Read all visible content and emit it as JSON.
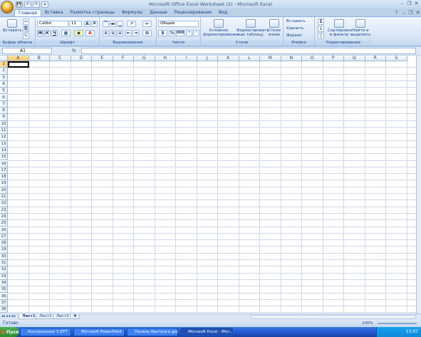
{
  "window": {
    "title": "Microsoft Office Excel Worksheet (2) - Microsoft Excel",
    "controls": [
      "–",
      "❐",
      "✕"
    ],
    "doc_controls": [
      "?",
      "–",
      "❐",
      "✕"
    ]
  },
  "qat": [
    "💾",
    "↶",
    "↷",
    "▾"
  ],
  "tabs": [
    "Главная",
    "Вставка",
    "Разметка страницы",
    "Формулы",
    "Данные",
    "Рецензирование",
    "Вид"
  ],
  "ribbon": {
    "clipboard": {
      "label": "Буфер обмена",
      "paste": "Вставить"
    },
    "font": {
      "label": "Шрифт",
      "name": "Calibri",
      "size": "11",
      "bold": "Ж",
      "italic": "К",
      "underline": "Ч",
      "grow": "A",
      "shrink": "A"
    },
    "align": {
      "label": "Выравнивание"
    },
    "number": {
      "label": "Число",
      "format": "Общий",
      "percent": "%",
      "thousands": "000"
    },
    "styles": {
      "label": "Стили",
      "cond": "Условное форматирование",
      "table": "Форматировать как таблицу",
      "cell": "Стили ячеек"
    },
    "cells": {
      "label": "Ячейки",
      "insert": "Вставить",
      "delete": "Удалить",
      "format": "Формат"
    },
    "editing": {
      "label": "Редактирование",
      "sum": "Σ",
      "sort": "Сортировка и фильтр",
      "find": "Найти и выделить"
    }
  },
  "formula_bar": {
    "cell_ref": "A1",
    "fx": "fx",
    "value": ""
  },
  "columns": [
    "A",
    "B",
    "C",
    "D",
    "E",
    "F",
    "G",
    "H",
    "I",
    "J",
    "K",
    "L",
    "M",
    "N",
    "O",
    "P",
    "Q",
    "R",
    "S"
  ],
  "rows": [
    "1",
    "2",
    "3",
    "4",
    "5",
    "6",
    "7",
    "8",
    "9",
    "10",
    "11",
    "12",
    "13",
    "14",
    "15",
    "16",
    "17",
    "18",
    "19",
    "20",
    "21",
    "22",
    "23",
    "24",
    "25",
    "26",
    "27",
    "28",
    "29",
    "30",
    "31",
    "32",
    "33",
    "34",
    "35",
    "36",
    "37",
    "38"
  ],
  "sheets": [
    "Лист1",
    "Лист2",
    "Лист3"
  ],
  "status": {
    "ready": "Готово",
    "zoom": "100%"
  },
  "taskbar": {
    "start": "Пуск",
    "items": [
      "Контрольная 3 ИТТ",
      "Microsoft PowerPoint - [...",
      "Панель быстрого дост...",
      "Microsoft Excel - Micr..."
    ],
    "clock": "13:07"
  }
}
